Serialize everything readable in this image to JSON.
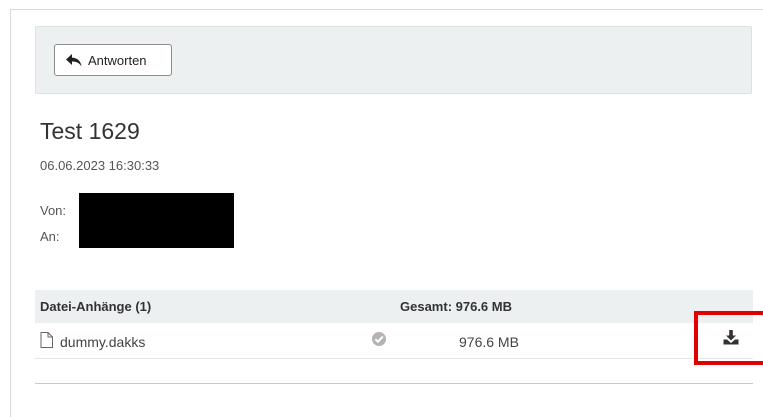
{
  "toolbar": {
    "reply_label": "Antworten"
  },
  "message": {
    "subject": "Test 1629",
    "date": "06.06.2023 16:30:33",
    "from_label": "Von:",
    "to_label": "An:"
  },
  "attachments": {
    "header_title": "Datei-Anhänge (1)",
    "header_total": "Gesamt: 976.6 MB",
    "items": [
      {
        "name": "dummy.dakks",
        "size": "976.6 MB",
        "status": "verified"
      }
    ]
  },
  "colors": {
    "panel_bg": "#ecf0f1",
    "highlight": "#e00000"
  },
  "icons": [
    "reply-icon",
    "file-icon",
    "check-circle-icon",
    "download-icon"
  ]
}
